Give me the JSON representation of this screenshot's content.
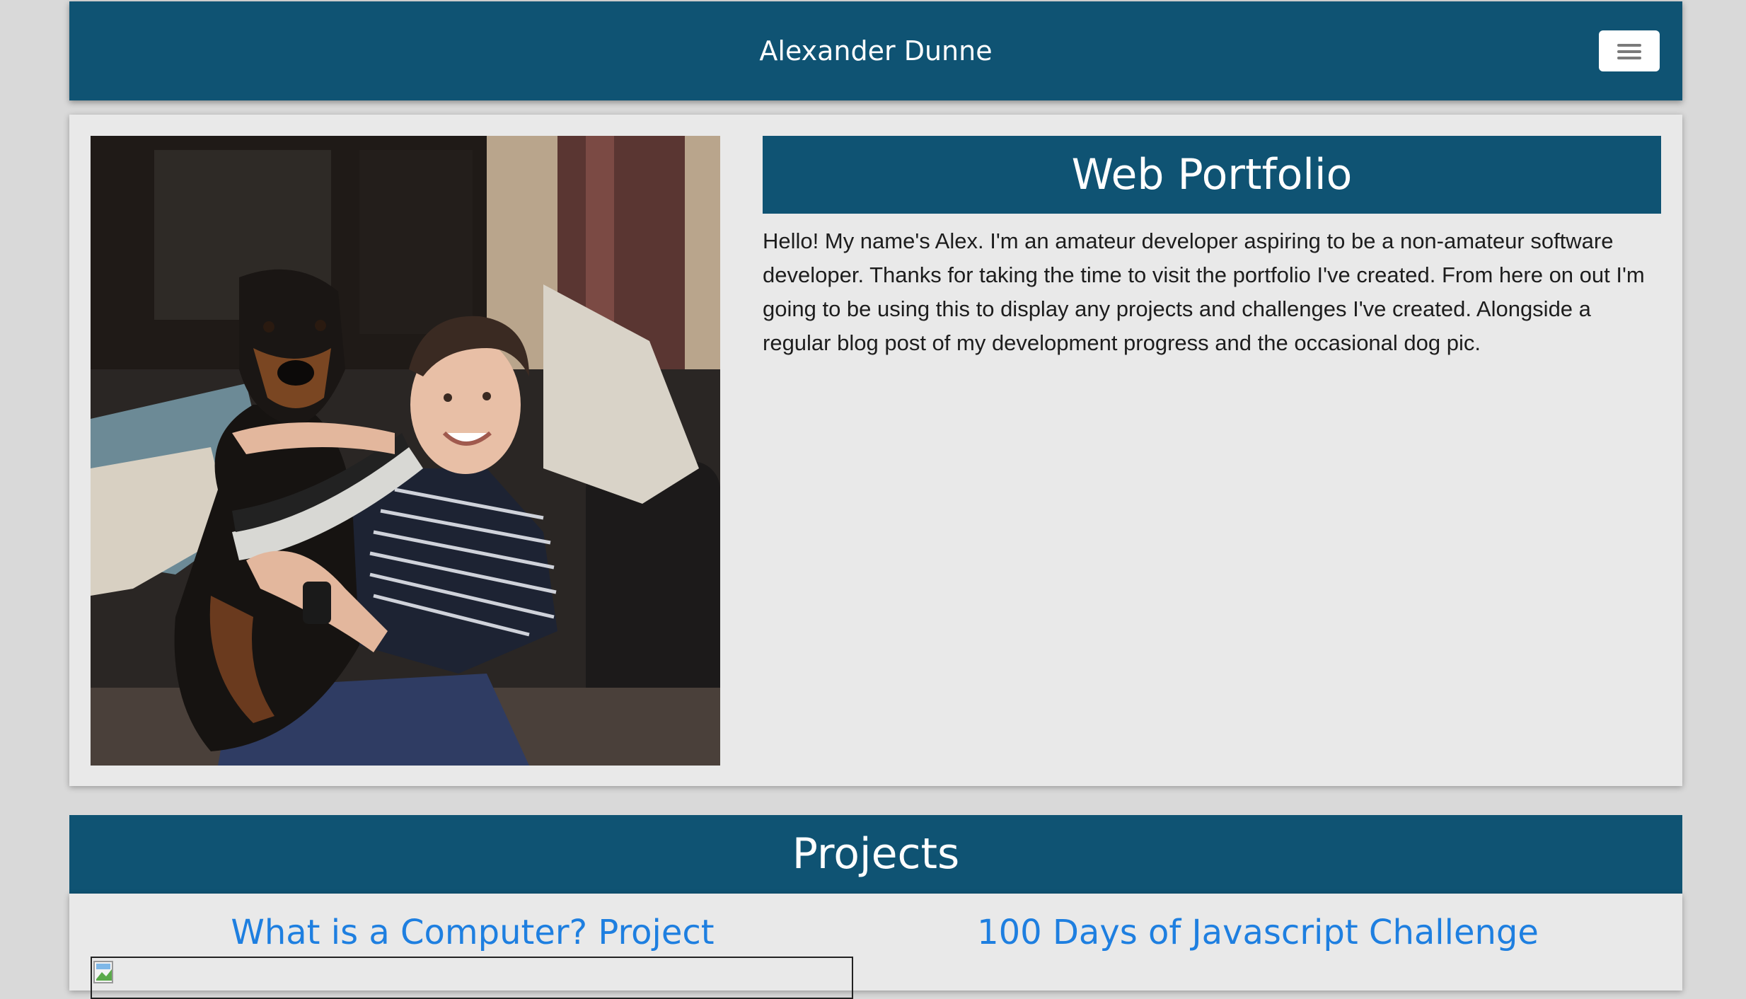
{
  "navbar": {
    "brand": "Alexander Dunne",
    "menu_icon": "hamburger-menu-icon"
  },
  "intro": {
    "photo_alt": "Alex with dog",
    "heading": "Web Portfolio",
    "text": "Hello! My name's Alex. I'm an amateur developer aspiring to be a non-amateur software developer. Thanks for taking the time to visit the portfolio I've created. From here on out I'm going to be using this to display any projects and challenges I've created. Alongside a regular blog post of my development progress and the occasional dog pic."
  },
  "projects": {
    "heading": "Projects",
    "items": [
      {
        "title": "What is a Computer? Project"
      },
      {
        "title": "100 Days of Javascript Challenge"
      }
    ]
  },
  "colors": {
    "primary": "#0f5373",
    "link": "#1e7fe0",
    "card_bg": "#e9e9e9",
    "page_bg": "#d9d9d9"
  }
}
